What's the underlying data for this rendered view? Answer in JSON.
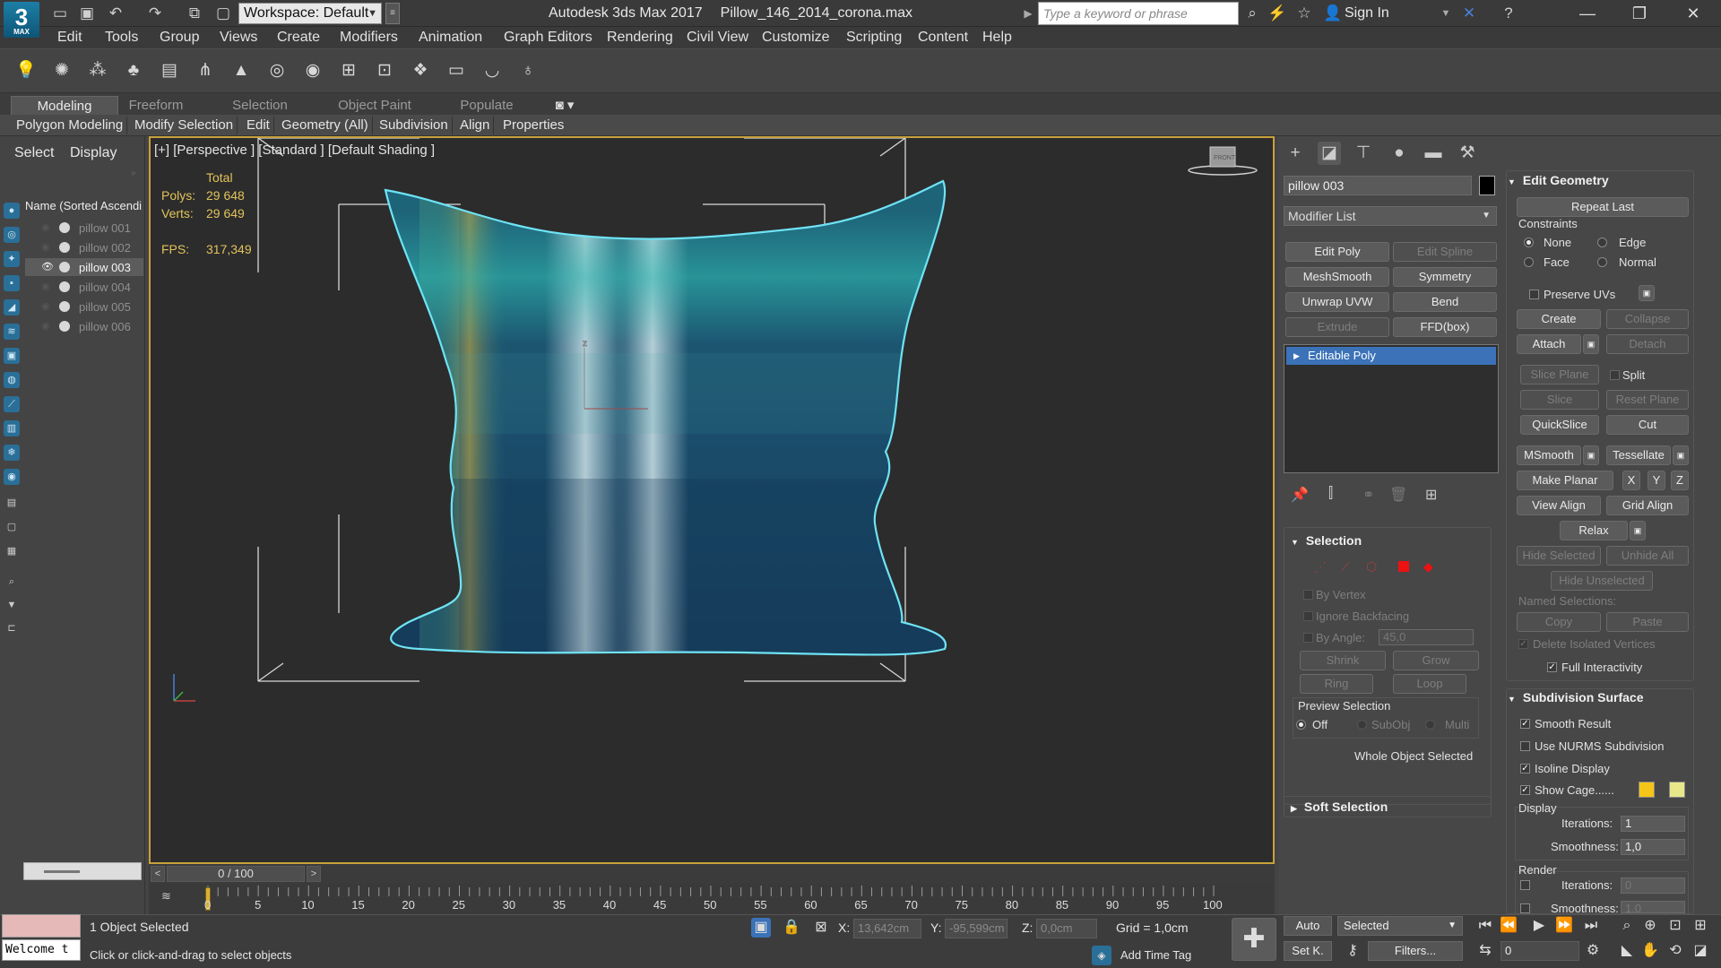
{
  "title_bar": {
    "logo": "3",
    "logo_sub": "MAX",
    "workspace": "Workspace: Default",
    "app_name": "Autodesk 3ds Max 2017",
    "file_name": "Pillow_146_2014_corona.max",
    "search_placeholder": "Type a keyword or phrase",
    "sign_in": "Sign In"
  },
  "menu": [
    "Edit",
    "Tools",
    "Group",
    "Views",
    "Create",
    "Modifiers",
    "Animation",
    "Graph Editors",
    "Rendering",
    "Civil View",
    "Customize",
    "Scripting",
    "Content",
    "Help"
  ],
  "ribbon": {
    "tabs": [
      "Modeling",
      "Freeform",
      "Selection",
      "Object Paint",
      "Populate"
    ],
    "buttons": [
      "Polygon Modeling",
      "Modify Selection",
      "Edit",
      "Geometry (All)",
      "Subdivision",
      "Align",
      "Properties"
    ]
  },
  "explorer": {
    "tabs": [
      "Select",
      "Display"
    ],
    "header": "Name (Sorted Ascendi",
    "items": [
      "pillow 001",
      "pillow 002",
      "pillow 003",
      "pillow 004",
      "pillow 005",
      "pillow 006"
    ],
    "selected_index": 2
  },
  "viewport": {
    "label": "[+] [Perspective ] [Standard ] [Default Shading ]",
    "stats_total": "Total",
    "polys_label": "Polys:",
    "polys": "29 648",
    "verts_label": "Verts:",
    "verts": "29 649",
    "fps_label": "FPS:",
    "fps": "317,349",
    "viewcube": "FRONT"
  },
  "timeline": {
    "frame": "0 / 100",
    "ticks": [
      "0",
      "5",
      "10",
      "15",
      "20",
      "25",
      "30",
      "35",
      "40",
      "45",
      "50",
      "55",
      "60",
      "65",
      "70",
      "75",
      "80",
      "85",
      "90",
      "95",
      "100"
    ]
  },
  "command_panel": {
    "object_name": "pillow 003",
    "modifier_list": "Modifier List",
    "modifier_buttons": [
      "Edit Poly",
      "Edit Spline",
      "MeshSmooth",
      "Symmetry",
      "Unwrap UVW",
      "Bend",
      "Extrude",
      "FFD(box)"
    ],
    "stack_item": "Editable Poly",
    "selection": {
      "title": "Selection",
      "by_vertex": "By Vertex",
      "ignore_backfacing": "Ignore Backfacing",
      "by_angle": "By Angle:",
      "angle": "45,0",
      "shrink": "Shrink",
      "grow": "Grow",
      "ring": "Ring",
      "loop": "Loop",
      "preview": "Preview Selection",
      "off": "Off",
      "subobj": "SubObj",
      "multi": "Multi",
      "status": "Whole Object Selected"
    },
    "soft_selection": "Soft Selection",
    "edit_geometry": {
      "title": "Edit Geometry",
      "repeat_last": "Repeat Last",
      "constraints": "Constraints",
      "none": "None",
      "edge": "Edge",
      "face": "Face",
      "normal": "Normal",
      "preserve_uvs": "Preserve UVs",
      "create": "Create",
      "collapse": "Collapse",
      "attach": "Attach",
      "detach": "Detach",
      "slice_plane": "Slice Plane",
      "split": "Split",
      "slice": "Slice",
      "reset_plane": "Reset Plane",
      "quickslice": "QuickSlice",
      "cut": "Cut",
      "msmooth": "MSmooth",
      "tessellate": "Tessellate",
      "make_planar": "Make Planar",
      "x": "X",
      "y": "Y",
      "z": "Z",
      "view_align": "View Align",
      "grid_align": "Grid Align",
      "relax": "Relax",
      "hide_selected": "Hide Selected",
      "unhide_all": "Unhide All",
      "hide_unselected": "Hide Unselected",
      "named_selections": "Named Selections:",
      "copy": "Copy",
      "paste": "Paste",
      "delete_isolated": "Delete Isolated Vertices",
      "full_interactivity": "Full Interactivity"
    },
    "subdivision": {
      "title": "Subdivision Surface",
      "smooth_result": "Smooth Result",
      "use_nurms": "Use NURMS Subdivision",
      "isoline": "Isoline Display",
      "show_cage": "Show Cage......",
      "display": "Display",
      "iterations_label": "Iterations:",
      "iterations": "1",
      "smoothness_label": "Smoothness:",
      "smoothness": "1,0",
      "render": "Render",
      "render_iterations": "0",
      "render_smoothness_label": "Smoothness:",
      "render_smoothness": "1,0",
      "cage_color1": "#f5c518",
      "cage_color2": "#e8e88a"
    }
  },
  "status": {
    "welcome": "Welcome t",
    "selected": "1 Object Selected",
    "prompt": "Click or click-and-drag to select objects",
    "x_label": "X:",
    "x": "13,642cm",
    "y_label": "Y:",
    "y": "-95,599cm",
    "z_label": "Z:",
    "z": "0,0cm",
    "grid": "Grid = 1,0cm",
    "add_time_tag": "Add Time Tag",
    "auto": "Auto",
    "set_key": "Set K.",
    "selected_dropdown": "Selected",
    "filters": "Filters...",
    "frame_field": "0"
  },
  "colors": {
    "accent": "#3b72b8",
    "viewport_border": "#c8a23a",
    "stats_text": "#e2c35b",
    "selection_outline": "#6fe3f5"
  }
}
